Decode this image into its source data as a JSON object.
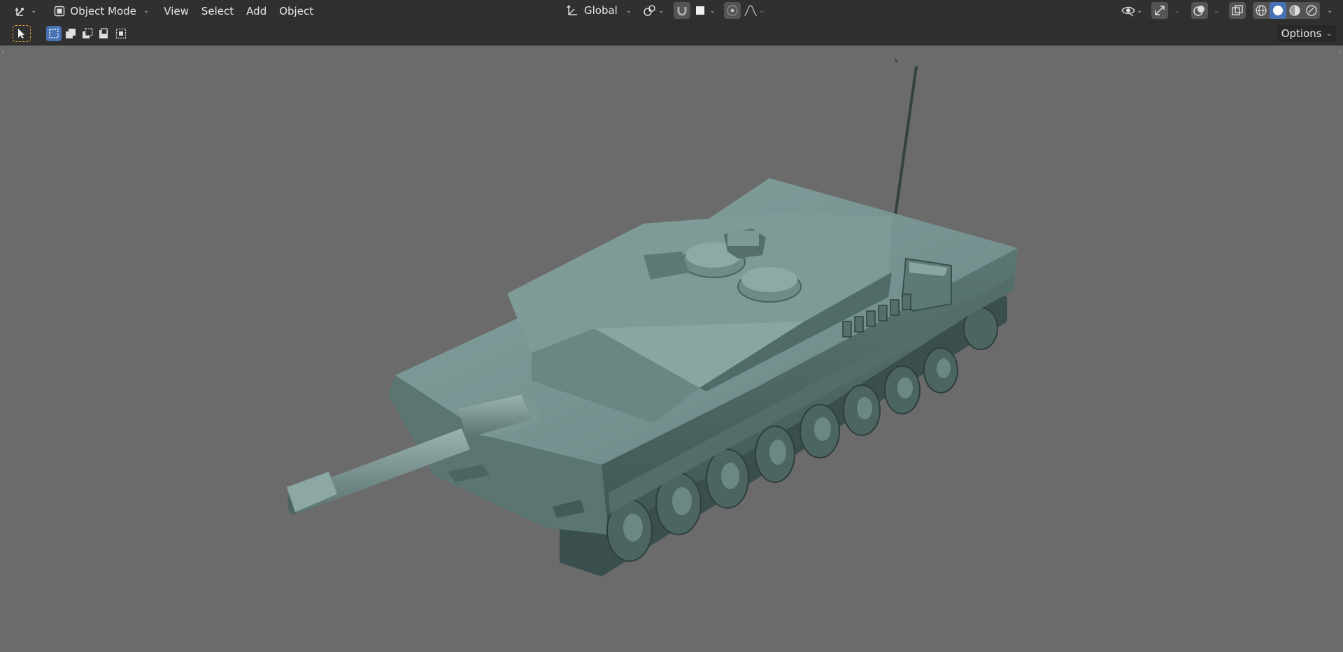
{
  "header": {
    "editor_type_icon": "transform-gizmo-icon",
    "mode": {
      "icon": "object-mode-icon",
      "label": "Object Mode"
    },
    "menus": [
      "View",
      "Select",
      "Add",
      "Object"
    ],
    "transform_orientation": {
      "icon": "orientation-axes-icon",
      "label": "Global"
    },
    "pivot_icon": "pivot-point-icon",
    "snap_icon": "snap-magnet-icon",
    "snap_target_icon": "snap-square-icon",
    "proportional_icon": "proportional-editing-icon",
    "falloff_icon": "falloff-curve-icon",
    "right_icons": [
      "visibility-eye-icon",
      "gizmo-icon",
      "overlay-icon",
      "xray-icon",
      "wireframe-shading-icon",
      "solid-shading-icon",
      "material-preview-icon",
      "rendered-shading-icon"
    ]
  },
  "toolbar": {
    "tool_icon": "select-box-tool-icon",
    "select_modes": [
      "set-new-selection-icon",
      "extend-selection-icon",
      "subtract-selection-icon",
      "invert-selection-icon",
      "intersect-selection-icon"
    ],
    "options_label": "Options"
  },
  "viewport": {
    "object": "tank-model",
    "background": "#6b6b6b",
    "model_color": "#5f7b78"
  },
  "colors": {
    "accent": "#4772b3",
    "header_bg": "#303030",
    "select_tool": "#e8a13a"
  }
}
